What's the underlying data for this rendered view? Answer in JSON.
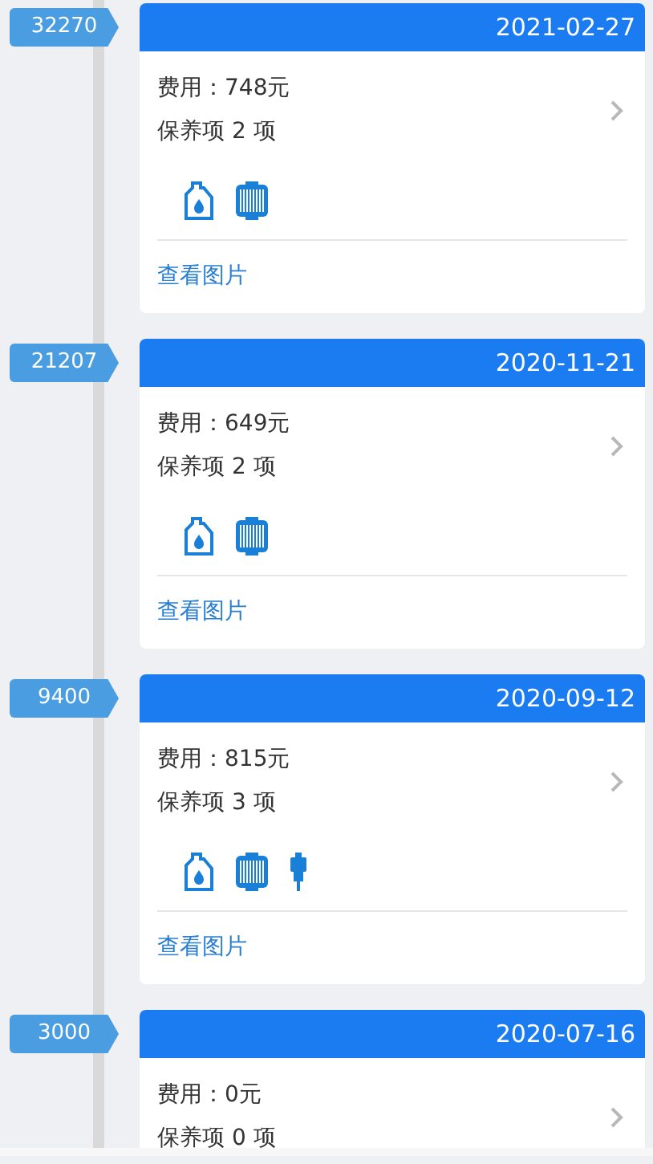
{
  "records": [
    {
      "mileage": "32270",
      "date": "2021-02-27",
      "cost": "费用：748元",
      "count": "保养项 2 项",
      "items": [
        {
          "kind": "oil"
        },
        {
          "kind": "filter"
        }
      ],
      "link": "查看图片"
    },
    {
      "mileage": "21207",
      "date": "2020-11-21",
      "cost": "费用：649元",
      "count": "保养项 2 项",
      "items": [
        {
          "kind": "oil"
        },
        {
          "kind": "filter"
        }
      ],
      "link": "查看图片"
    },
    {
      "mileage": "9400",
      "date": "2020-09-12",
      "cost": "费用：815元",
      "count": "保养项 3 项",
      "items": [
        {
          "kind": "oil"
        },
        {
          "kind": "filter"
        },
        {
          "kind": "plug"
        }
      ],
      "link": "查看图片"
    },
    {
      "mileage": "3000",
      "date": "2020-07-16",
      "cost": "费用：0元",
      "count": "保养项 0 项"
    }
  ]
}
